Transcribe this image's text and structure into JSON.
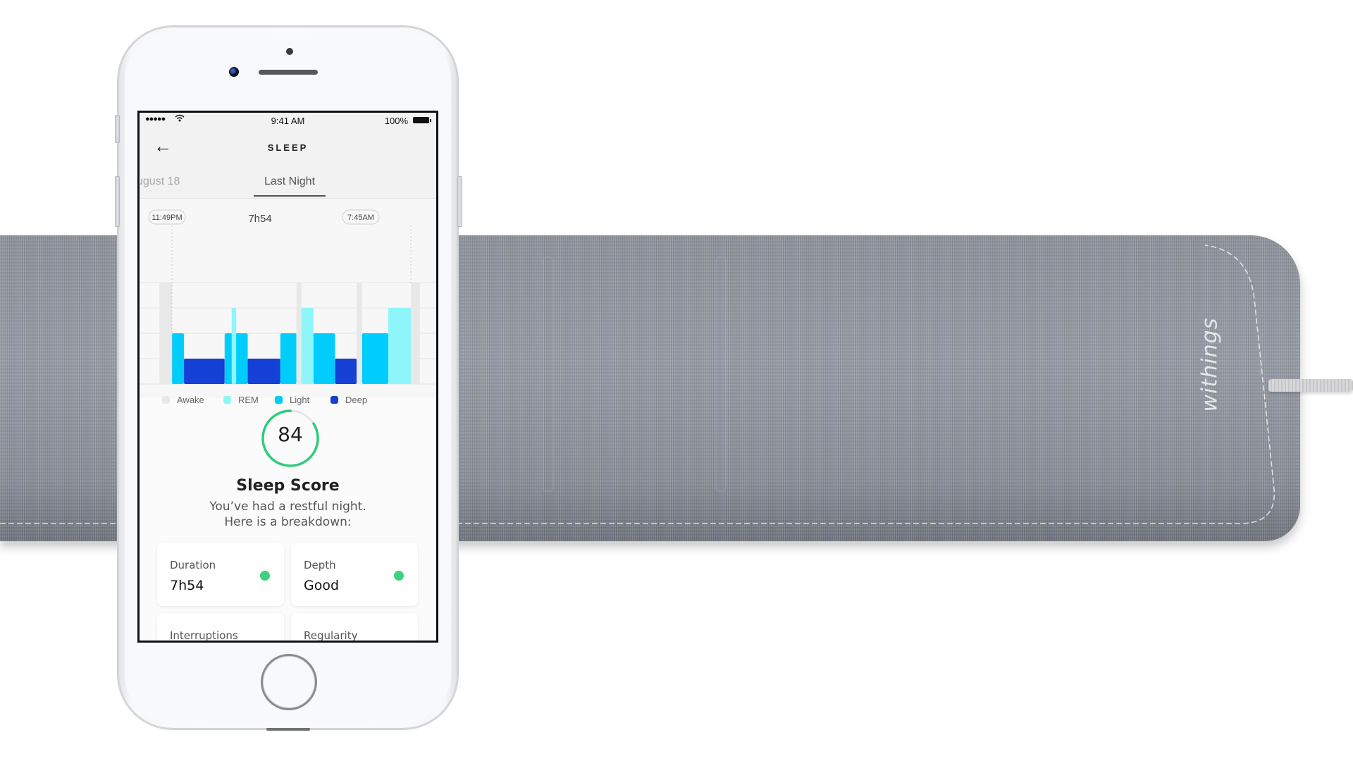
{
  "scene": {
    "brand_logo": "withings"
  },
  "status_bar": {
    "signal": "●●●●●",
    "wifi_icon": "wifi-icon",
    "time": "9:41 AM",
    "battery_pct": "100%"
  },
  "nav": {
    "back_icon": "←",
    "title": "SLEEP"
  },
  "tabs": {
    "previous": "ugust 18",
    "active": "Last Night"
  },
  "sleep_chart": {
    "start_label": "11:49PM",
    "end_label": "7:45AM",
    "duration_label": "7h54"
  },
  "chart_data": {
    "type": "bar",
    "title": "7h54",
    "xlabel": "",
    "ylabel": "",
    "x_start": "11:49PM",
    "x_end": "7:45AM",
    "x_unit": "minutes from 11:49PM",
    "stage_levels": {
      "Awake": 4,
      "REM": 3,
      "Light": 2,
      "Deep": 1
    },
    "legend": [
      "Awake",
      "REM",
      "Light",
      "Deep"
    ],
    "legend_placement": "bottom",
    "colors": {
      "Awake": "#e8e8e8",
      "REM": "#8ef6fa",
      "Light": "#00cdfb",
      "Deep": "#1440d6"
    },
    "segments": [
      {
        "stage": "Awake",
        "start": -25,
        "end": 0
      },
      {
        "stage": "Light",
        "start": 0,
        "end": 24
      },
      {
        "stage": "Deep",
        "start": 24,
        "end": 105
      },
      {
        "stage": "Light",
        "start": 105,
        "end": 151
      },
      {
        "stage": "REM",
        "start": 119,
        "end": 128
      },
      {
        "stage": "Deep",
        "start": 151,
        "end": 216
      },
      {
        "stage": "Light",
        "start": 216,
        "end": 248
      },
      {
        "stage": "Awake",
        "start": 248,
        "end": 258
      },
      {
        "stage": "REM",
        "start": 258,
        "end": 282
      },
      {
        "stage": "Light",
        "start": 282,
        "end": 325
      },
      {
        "stage": "Deep",
        "start": 325,
        "end": 368
      },
      {
        "stage": "Awake",
        "start": 368,
        "end": 379
      },
      {
        "stage": "Light",
        "start": 379,
        "end": 431
      },
      {
        "stage": "REM",
        "start": 431,
        "end": 476
      },
      {
        "stage": "Awake",
        "start": 476,
        "end": 494
      }
    ]
  },
  "legend": [
    {
      "label": "Awake",
      "color": "#e8e8e8"
    },
    {
      "label": "REM",
      "color": "#8ef6fa"
    },
    {
      "label": "Light",
      "color": "#00cdfb"
    },
    {
      "label": "Deep",
      "color": "#1440d6"
    }
  ],
  "score": {
    "value": "84",
    "progress": 0.84,
    "ring_color": "#2ecc7a",
    "title": "Sleep Score",
    "subtitle_line1": "You’ve had a restful night.",
    "subtitle_line2": "Here is a breakdown:"
  },
  "breakdown": [
    {
      "label": "Duration",
      "value": "7h54",
      "status_color": "#3dd17f"
    },
    {
      "label": "Depth",
      "value": "Good",
      "status_color": "#3dd17f"
    },
    {
      "label": "Interruptions",
      "value": "",
      "status_color": "#f5c518"
    },
    {
      "label": "Regularity",
      "value": "",
      "status_color": "#f04a3a"
    }
  ]
}
